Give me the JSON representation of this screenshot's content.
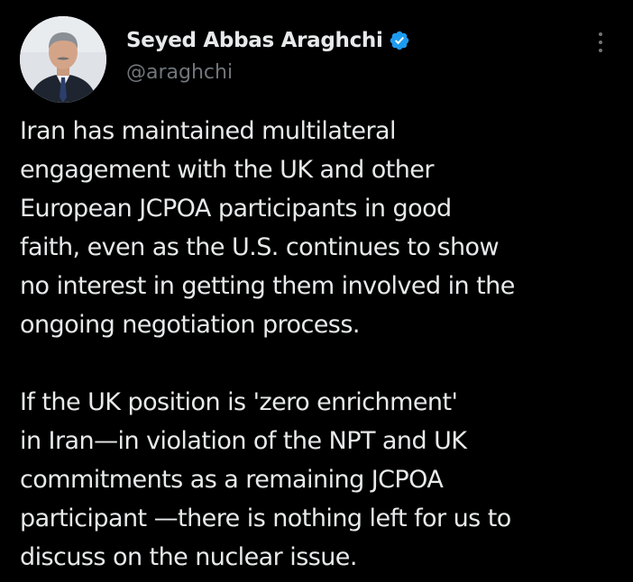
{
  "tweet": {
    "author": {
      "display_name": "Seyed Abbas Araghchi",
      "handle": "@araghchi",
      "verified": true,
      "avatar_icon": "profile-photo",
      "badge_icon": "verified-badge-icon",
      "badge_color": "#1d9bf0"
    },
    "more_icon": "more-vertical-icon",
    "paragraphs": [
      {
        "lines": [
          "Iran has maintained multilateral",
          "engagement with the UK and other",
          "European JCPOA participants in good",
          "faith, even as the U.S. continues to show",
          "no interest in getting them involved in the",
          "ongoing negotiation process."
        ]
      },
      {
        "lines": [
          "If the UK position is 'zero enrichment'",
          "in Iran—in violation of the NPT and UK",
          "commitments as a remaining JCPOA",
          "participant —there is nothing left for us to",
          "discuss on the nuclear issue."
        ]
      }
    ],
    "colors": {
      "background": "#000000",
      "text_primary": "#e7e9ea",
      "text_secondary": "#71767b"
    }
  }
}
